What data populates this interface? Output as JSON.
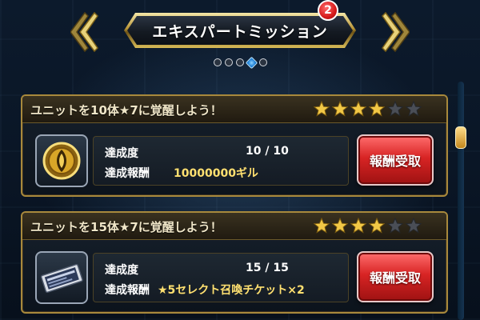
{
  "header": {
    "title": "エキスパートミッション",
    "badge_count": "2",
    "page_index": 4,
    "page_count": 5
  },
  "missions": [
    {
      "title": "ユニットを10体★7に覚醒しよう！",
      "stars_filled": 4,
      "stars_total": 6,
      "progress_label": "達成度",
      "progress_value": "10 / 10",
      "reward_label": "達成報酬",
      "reward_value": "10000000ギル",
      "icon": "gil-coin-icon",
      "button_label": "報酬受取"
    },
    {
      "title": "ユニットを15体★7に覚醒しよう！",
      "stars_filled": 4,
      "stars_total": 6,
      "progress_label": "達成度",
      "progress_value": "15 / 15",
      "reward_label": "達成報酬",
      "reward_value": "★5セレクト召喚チケット×2",
      "icon": "summon-ticket-icon",
      "button_label": "報酬受取"
    }
  ],
  "colors": {
    "gold": "#c9a64a",
    "claim_red": "#d82424",
    "reward_yellow": "#ffe070"
  }
}
